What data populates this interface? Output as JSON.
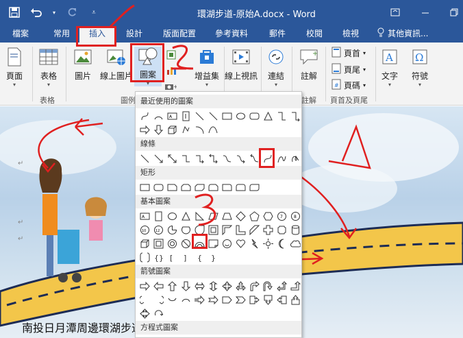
{
  "window": {
    "title": "環湖步道-原始A.docx - Word"
  },
  "tabs": [
    {
      "label": "檔案"
    },
    {
      "label": "常用"
    },
    {
      "label": "插入"
    },
    {
      "label": "設計"
    },
    {
      "label": "版面配置"
    },
    {
      "label": "參考資料"
    },
    {
      "label": "郵件"
    },
    {
      "label": "校閱"
    },
    {
      "label": "檢視"
    }
  ],
  "tellme": {
    "label": "其他資訊..."
  },
  "ribbon": {
    "page": "頁面",
    "table": "表格",
    "picture": "圖片",
    "online_picture": "線上圖片",
    "shapes": "圖案",
    "addins": "增益集",
    "online_video": "線上視訊",
    "link": "連結",
    "comment": "註解",
    "header": "頁首",
    "footer": "頁尾",
    "page_number": "頁碼",
    "text": "文字",
    "symbol": "符號",
    "group_table": "表格",
    "group_illustrations": "圖例",
    "group_comment": "註解",
    "group_header_footer": "頁首及頁尾"
  },
  "shapes_menu": {
    "recent": "最近使用的圖案",
    "lines": "線條",
    "rectangles": "矩形",
    "basic": "基本圖案",
    "arrows": "箭號圖案",
    "equation": "方程式圖案"
  },
  "document": {
    "text": "南投日月潭周邊環湖步道、年梯步道、伊達邵親水"
  },
  "colors": {
    "title_bar": "#2b579a",
    "annotation": "#e02020"
  }
}
